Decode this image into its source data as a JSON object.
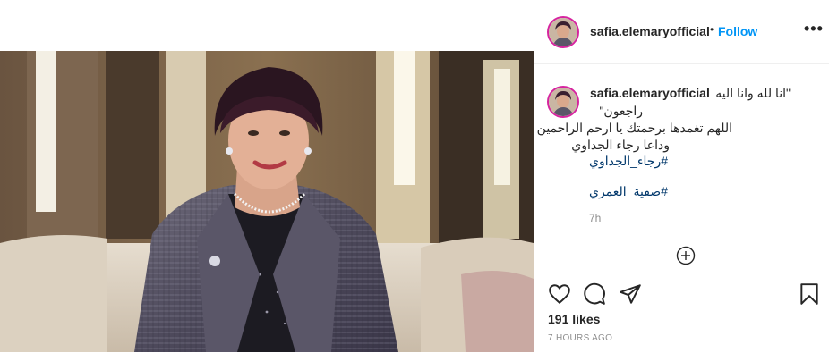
{
  "header": {
    "username": "safia.elemaryofficial",
    "dot": "•",
    "follow_label": "Follow",
    "more_label": "•••"
  },
  "caption": {
    "username": "safia.elemaryofficial",
    "line1": "\"انا لله وانا اليه",
    "line2": "راجعون\"",
    "line3": "اللهم تغمدها برحمتك يا ارحم الراحمين",
    "line4": "وداعا رجاء الجداوي",
    "hashtag1": "#رجاء_الجداوي",
    "hashtag2": "#صفية_العمري",
    "time": "7h"
  },
  "actions": {
    "likes": "191 likes",
    "posted_ago": "7 HOURS AGO"
  },
  "icons": {
    "like": "heart-icon",
    "comment": "comment-icon",
    "share": "share-icon",
    "save": "bookmark-icon",
    "load_more": "plus-circle-icon"
  },
  "colors": {
    "follow": "#0095f6",
    "hashtag": "#00376b",
    "muted": "#8e8e8e",
    "text": "#262626"
  }
}
